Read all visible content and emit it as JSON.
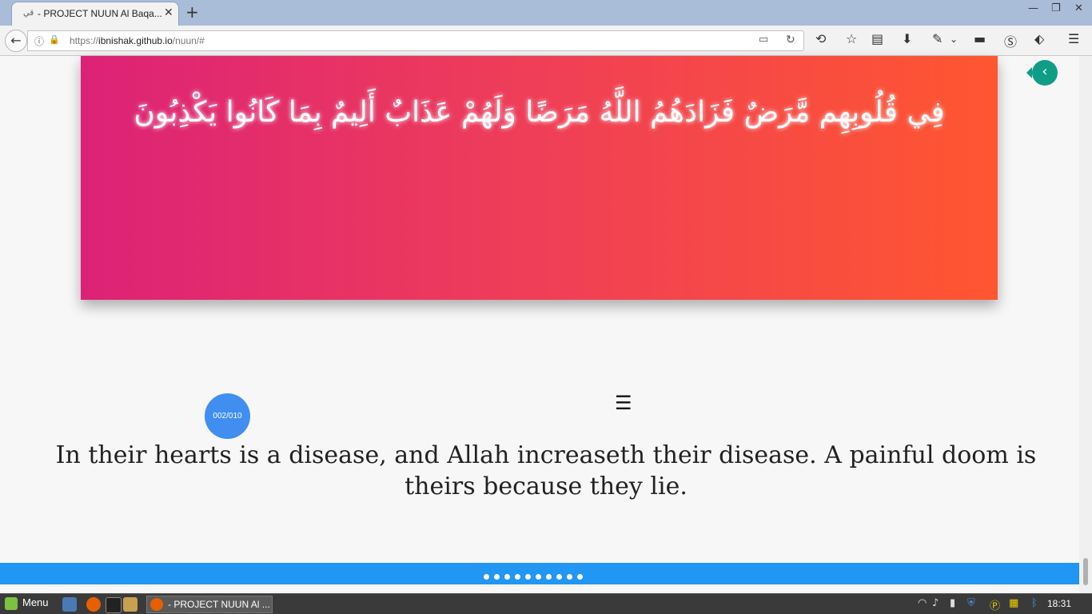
{
  "browser": {
    "tab_title": "- PROJECT NUUN Al Baqa...",
    "tab_favicon": "قي",
    "url_prefix": "https://",
    "url_domain": "ibnishak.github.io",
    "url_path": "/nuun/#"
  },
  "page": {
    "arabic_verse": "فِي قُلُوبِهِم مَّرَضٌ فَزَادَهُمُ اللَّهُ مَرَضًا وَلَهُمْ عَذَابٌ أَلِيمٌ بِمَا كَانُوا يَكْذِبُونَ",
    "counter": "002/010",
    "menu_glyph": "☰",
    "translation": "In their hearts is a disease, and Allah increaseth their disease. A painful doom is theirs because they lie.",
    "back_glyph": "‹",
    "dots_count": 10
  },
  "taskbar": {
    "menu_label": "Menu",
    "task_label": "- PROJECT NUUN Al ...",
    "clock": "18:31"
  },
  "colors": {
    "banner_left": "#dc2277",
    "banner_right": "#ff5630",
    "accent_blue": "#2196f3",
    "counter_blue": "#3f8ef0",
    "side_button": "#0f9d87"
  }
}
